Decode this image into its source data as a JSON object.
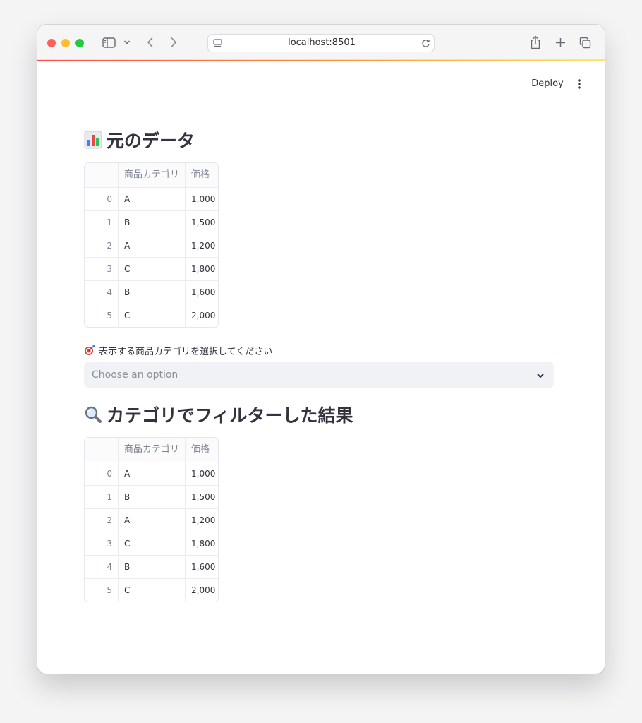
{
  "browser": {
    "url": "localhost:8501"
  },
  "app_header": {
    "deploy_label": "Deploy"
  },
  "sections": {
    "original_title": "元のデータ",
    "filtered_title": "カテゴリでフィルターした結果"
  },
  "filter": {
    "label": "表示する商品カテゴリを選択してください",
    "placeholder": "Choose an option"
  },
  "table_columns": [
    "商品カテゴリ",
    "価格"
  ],
  "original_table": [
    {
      "index": "0",
      "category": "A",
      "price": "1,000"
    },
    {
      "index": "1",
      "category": "B",
      "price": "1,500"
    },
    {
      "index": "2",
      "category": "A",
      "price": "1,200"
    },
    {
      "index": "3",
      "category": "C",
      "price": "1,800"
    },
    {
      "index": "4",
      "category": "B",
      "price": "1,600"
    },
    {
      "index": "5",
      "category": "C",
      "price": "2,000"
    }
  ],
  "filtered_table": [
    {
      "index": "0",
      "category": "A",
      "price": "1,000"
    },
    {
      "index": "1",
      "category": "B",
      "price": "1,500"
    },
    {
      "index": "2",
      "category": "A",
      "price": "1,200"
    },
    {
      "index": "3",
      "category": "C",
      "price": "1,800"
    },
    {
      "index": "4",
      "category": "B",
      "price": "1,600"
    },
    {
      "index": "5",
      "category": "C",
      "price": "2,000"
    }
  ],
  "icons": {
    "original_heading": "bar-chart-icon",
    "filter_label": "direct-hit-target-icon",
    "filtered_heading": "magnifying-glass-icon"
  },
  "colors": {
    "accent_gradient": [
      "#ff4b4b",
      "#fd8c3a",
      "#ffe168"
    ],
    "text": "#31333f",
    "muted_text": "#808495",
    "select_background": "#f0f2f6"
  }
}
